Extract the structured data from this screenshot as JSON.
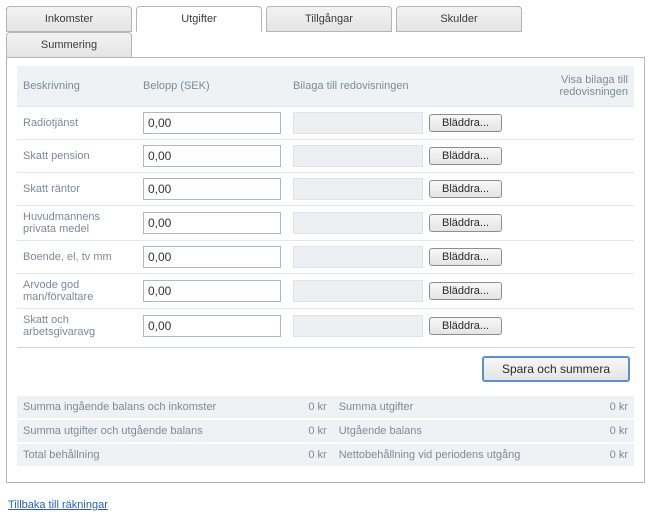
{
  "tabs": {
    "inkomster": "Inkomster",
    "utgifter": "Utgifter",
    "tillgangar": "Tillgångar",
    "skulder": "Skulder",
    "summering": "Summering"
  },
  "headers": {
    "desc": "Beskrivning",
    "amount": "Belopp (SEK)",
    "attach": "Bilaga till redovisningen",
    "showattach": "Visa bilaga till redovisningen"
  },
  "browse_label": "Bläddra...",
  "save_label": "Spara och summera",
  "rows": [
    {
      "label": "Radiotjänst",
      "value": "0,00"
    },
    {
      "label": "Skatt pension",
      "value": "0,00"
    },
    {
      "label": "Skatt räntor",
      "value": "0,00"
    },
    {
      "label": "Huvudmannens privata medel",
      "value": "0,00"
    },
    {
      "label": "Boende, el, tv mm",
      "value": "0,00"
    },
    {
      "label": "Arvode god man/förvaltare",
      "value": "0,00"
    },
    {
      "label": "Skatt och arbetsgivaravg",
      "value": "0,00"
    }
  ],
  "summary": {
    "r0": {
      "l": "Summa ingående balans och inkomster",
      "lv": "0 kr",
      "r": "Summa utgifter",
      "rv": "0 kr"
    },
    "r1": {
      "l": "Summa utgifter och utgående balans",
      "lv": "0 kr",
      "r": "Utgående balans",
      "rv": "0 kr"
    },
    "r2": {
      "l": "Total behållning",
      "lv": "0 kr",
      "r": "Nettobehållning vid periodens utgång",
      "rv": "0 kr"
    }
  },
  "back_link": "Tillbaka till räkningar"
}
